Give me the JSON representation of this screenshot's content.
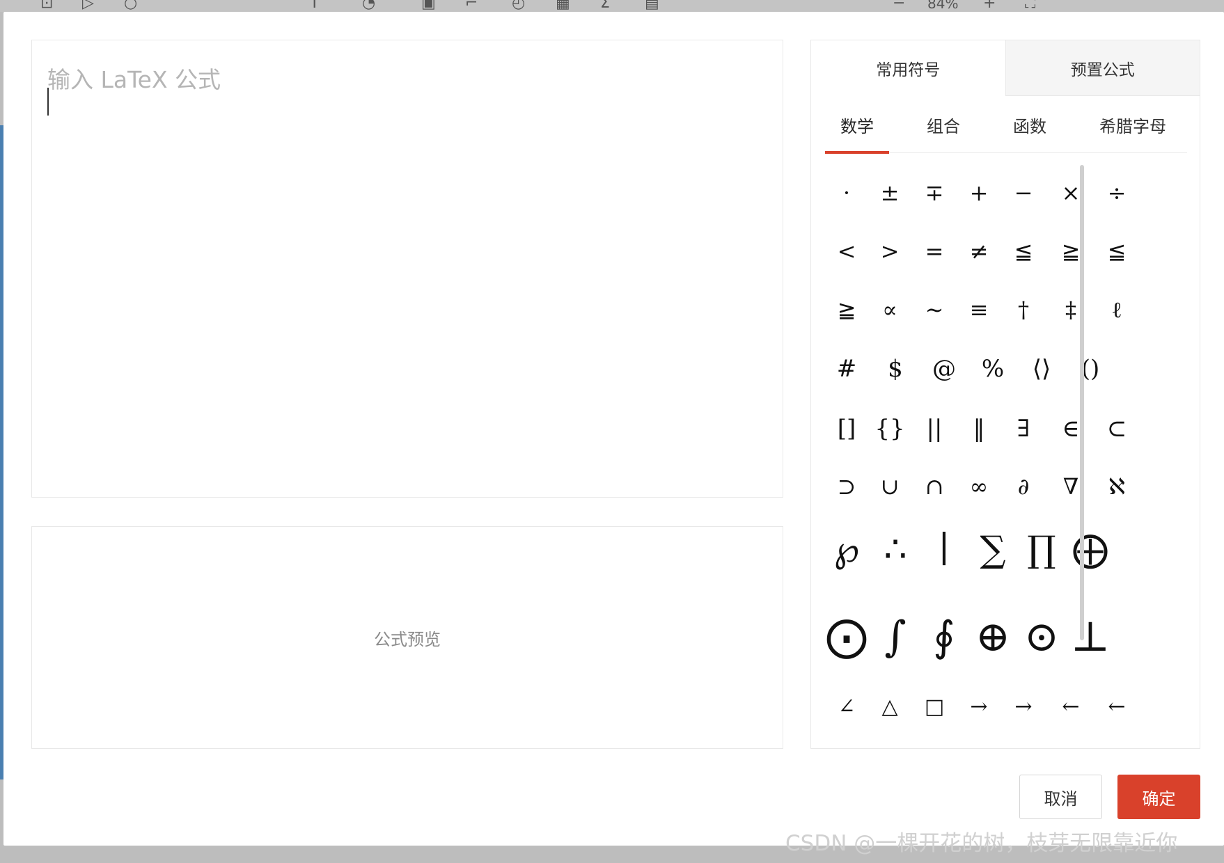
{
  "toolbar": {
    "zoom": "84%",
    "zoom_out": "−",
    "zoom_in": "+"
  },
  "editor": {
    "placeholder": "输入 LaTeX 公式",
    "value": ""
  },
  "preview": {
    "placeholder": "公式预览"
  },
  "panel": {
    "tabs": [
      {
        "label": "常用符号",
        "active": true
      },
      {
        "label": "预置公式",
        "active": false
      }
    ],
    "subtabs": [
      {
        "label": "数学",
        "active": true
      },
      {
        "label": "组合",
        "active": false
      },
      {
        "label": "函数",
        "active": false
      },
      {
        "label": "希腊字母",
        "active": false
      }
    ],
    "symbols": [
      [
        "·",
        "±",
        "∓",
        "+",
        "−",
        "×",
        "÷"
      ],
      [
        "<",
        ">",
        "=",
        "≠",
        "≦",
        "≧",
        "≦"
      ],
      [
        "≧",
        "∝",
        "∼",
        "≡",
        "†",
        "‡",
        "ℓ"
      ],
      [
        "#",
        "$",
        "@",
        "%",
        "⟨⟩",
        "()"
      ],
      [
        "[]",
        "{}",
        "||",
        "‖",
        "∃",
        "∈",
        "⊂"
      ],
      [
        "⊃",
        "∪",
        "∩",
        "∞",
        "∂",
        "∇",
        "ℵ"
      ],
      [
        "℘",
        "∴",
        "∣",
        "∑",
        "∏",
        "⨁"
      ],
      [
        "⨀",
        "∫",
        "∮",
        "⊕",
        "⊙",
        "⊥"
      ],
      [
        "∠",
        "△",
        "□",
        "→",
        "→",
        "←",
        "←"
      ]
    ]
  },
  "buttons": {
    "cancel": "取消",
    "ok": "确定"
  },
  "watermark": "CSDN @一棵开花的树，枝芽无限靠近你",
  "colors": {
    "accent": "#d9412b"
  }
}
